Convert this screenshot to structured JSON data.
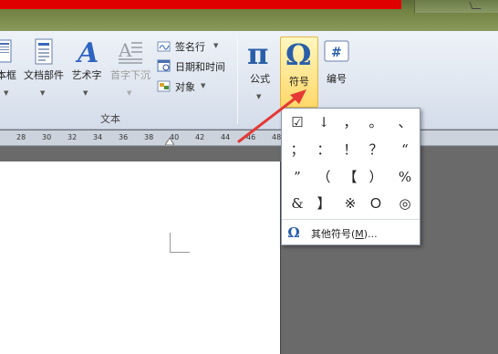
{
  "ribbon": {
    "buttons": {
      "textbox": "本框",
      "quickparts": "文档部件",
      "wordart": "艺术字",
      "dropcap": "首字下沉",
      "signature": "签名行",
      "datetime": "日期和时间",
      "object": "对象",
      "equation": "公式",
      "symbol": "符号",
      "number": "编号"
    },
    "group_label": "文本"
  },
  "ruler": {
    "ticks": [
      "28",
      "30",
      "32",
      "34",
      "36",
      "38",
      "40",
      "42",
      "44",
      "46",
      "48"
    ]
  },
  "symbols": {
    "rows": [
      [
        "☑",
        "↓",
        "，",
        "。",
        "、"
      ],
      [
        "；",
        "：",
        "！",
        "？",
        "“"
      ],
      [
        "”",
        "（",
        "【",
        "）",
        "%"
      ],
      [
        "&",
        "】",
        "※",
        "Ｏ",
        "◎"
      ]
    ],
    "more_symbols": {
      "label": "其他符号(",
      "mnemonic": "M",
      "suffix": ")..."
    }
  },
  "colors": {
    "title_red": "#e00000",
    "accent_arrow": "#e53935",
    "symbol_icon_blue": "#2a5ea8",
    "wordart_blue": "#2f63c2"
  },
  "icons": [
    "textbox-icon",
    "quickparts-icon",
    "wordart-icon",
    "dropcap-icon",
    "signature-icon",
    "datetime-icon",
    "object-icon",
    "pi-icon",
    "omega-icon",
    "number-icon"
  ]
}
